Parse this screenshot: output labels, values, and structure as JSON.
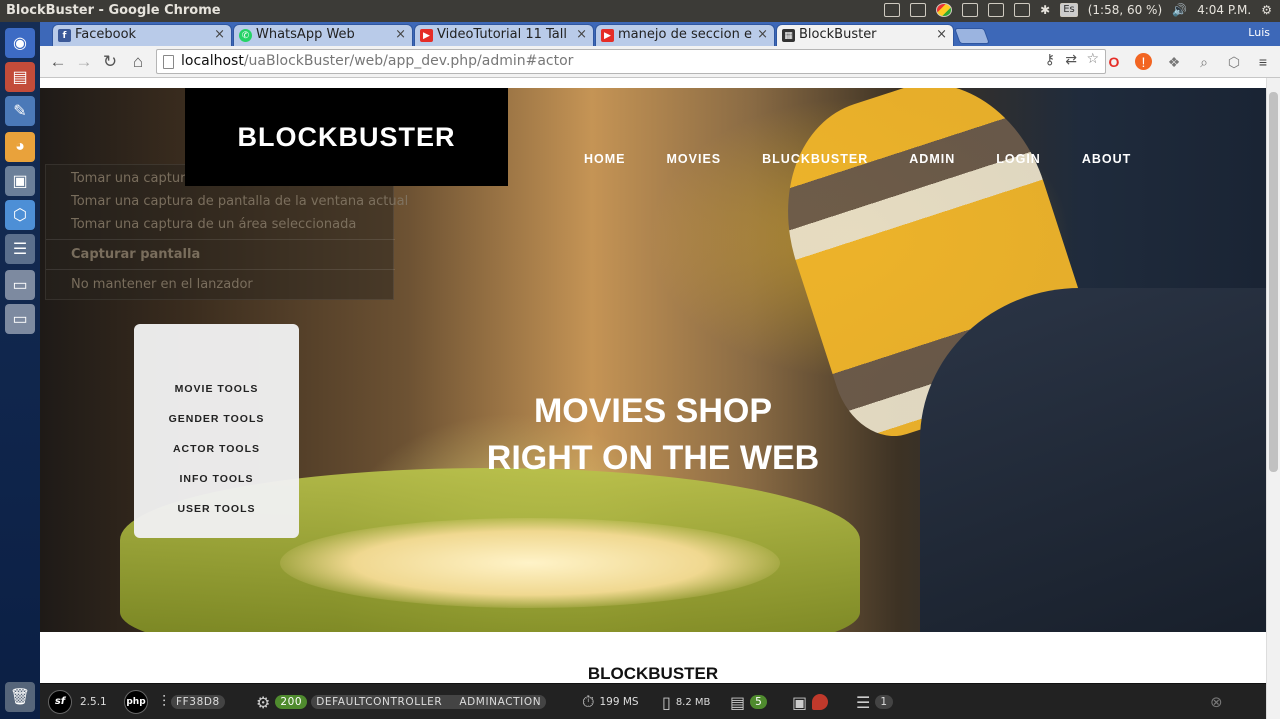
{
  "window": {
    "title": "BlockBuster - Google Chrome"
  },
  "tray": {
    "keyboard": "Es",
    "battery": "(1:58, 60 %)",
    "time": "4:04 P.M."
  },
  "tabs": [
    {
      "label": "Facebook",
      "favicon": "facebook-icon",
      "color": "#3b5998"
    },
    {
      "label": "WhatsApp Web",
      "favicon": "whatsapp-icon",
      "color": "#25d366"
    },
    {
      "label": "VideoTutorial 11 Tall",
      "favicon": "youtube-icon",
      "color": "#e52d27"
    },
    {
      "label": "manejo de seccion e",
      "favicon": "youtube-icon",
      "color": "#e52d27"
    },
    {
      "label": "BlockBuster",
      "favicon": "film-icon",
      "color": "#333333"
    }
  ],
  "profile": "Luis",
  "address": {
    "host": "localhost",
    "path": "/uaBlockBuster/web/app_dev.php/admin#actor"
  },
  "site": {
    "brand": "BLOCKBUSTER",
    "nav": [
      "HOME",
      "MOVIES",
      "BLUCKBUSTER",
      "ADMIN",
      "LOGIN",
      "ABOUT"
    ],
    "tagline": [
      "MOVIES SHOP",
      "RIGHT ON THE WEB"
    ],
    "admin_menu": [
      "MOVIE TOOLS",
      "GENDER TOOLS",
      "ACTOR TOOLS",
      "INFO TOOLS",
      "USER TOOLS"
    ],
    "section_title": "BLOCKBUSTER"
  },
  "context_menu": {
    "items": [
      "Tomar una captura de pantalla completa",
      "Tomar una captura de pantalla de la ventana actual",
      "Tomar una captura de un área seleccionada"
    ],
    "heading": "Capturar pantalla",
    "footer": "No mantener en el lanzador"
  },
  "symfony_toolbar": {
    "version": "2.5.1",
    "php": "php",
    "token": "FF38D8",
    "status": "200",
    "controller": "DEFAULTCONTROLLER",
    "action": "ADMINACTION",
    "time": "199 MS",
    "memory": "8.2 MB",
    "forms": "5",
    "queries": "1"
  }
}
